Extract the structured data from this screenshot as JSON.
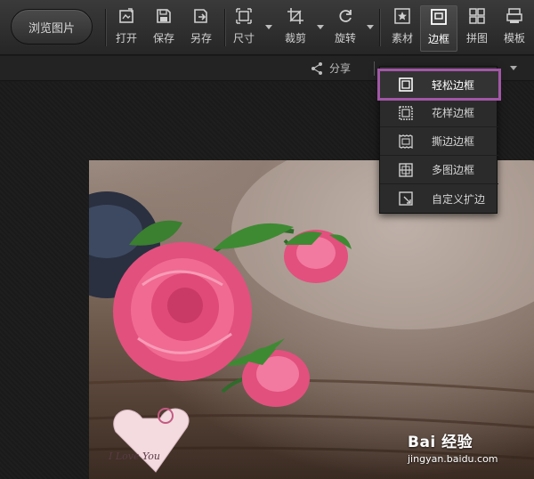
{
  "toolbar": {
    "browse_label": "浏览图片",
    "tools": [
      {
        "name": "open",
        "label": "打开",
        "icon": "open-icon"
      },
      {
        "name": "save",
        "label": "保存",
        "icon": "save-icon"
      },
      {
        "name": "saveas",
        "label": "另存",
        "icon": "save-as-icon"
      },
      {
        "name": "size",
        "label": "尺寸",
        "icon": "resize-icon"
      },
      {
        "name": "crop",
        "label": "裁剪",
        "icon": "crop-icon"
      },
      {
        "name": "rotate",
        "label": "旋转",
        "icon": "rotate-icon"
      },
      {
        "name": "material",
        "label": "素材",
        "icon": "star-icon"
      },
      {
        "name": "border",
        "label": "边框",
        "icon": "frame-icon",
        "active": true
      },
      {
        "name": "puzzle",
        "label": "拼图",
        "icon": "grid-icon"
      },
      {
        "name": "template",
        "label": "模板",
        "icon": "template-icon"
      }
    ]
  },
  "subbar": {
    "share_label": "分享"
  },
  "border_menu": {
    "items": [
      {
        "label": "轻松边框",
        "icon": "simple-frame-icon",
        "highlighted": true
      },
      {
        "label": "花样边框",
        "icon": "pattern-frame-icon"
      },
      {
        "label": "撕边边框",
        "icon": "torn-edge-frame-icon"
      },
      {
        "label": "多图边框",
        "icon": "multi-frame-icon"
      },
      {
        "label": "自定义扩边",
        "icon": "custom-expand-icon"
      }
    ]
  },
  "photo": {
    "heart_text": "I Love You"
  },
  "watermark": {
    "brand": "Bai  经验",
    "url": "jingyan.baidu.com"
  },
  "colors": {
    "highlight": "#a256a7",
    "toolbar_bg": "#2e2e2e",
    "rose": "#e2507e"
  }
}
